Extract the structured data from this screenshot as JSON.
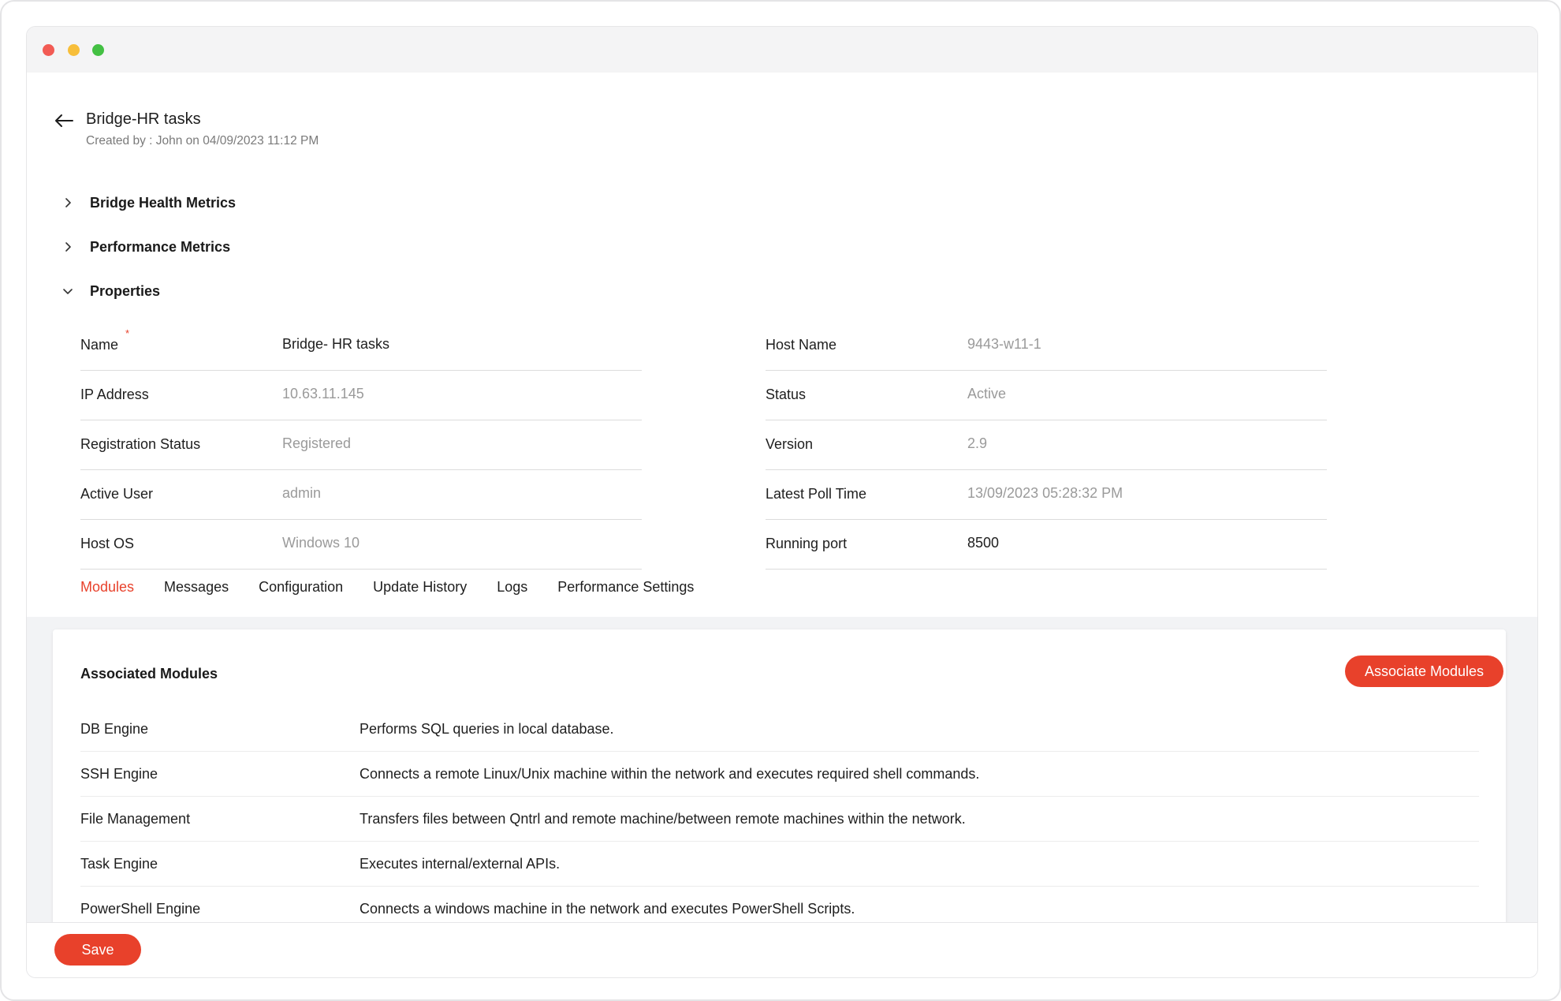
{
  "header": {
    "title": "Bridge-HR tasks",
    "subtitle": "Created by : John on 04/09/2023 11:12 PM"
  },
  "sections": {
    "health": "Bridge Health Metrics",
    "performance": "Performance Metrics",
    "properties": "Properties"
  },
  "properties": {
    "left": [
      {
        "label": "Name",
        "value": "Bridge- HR tasks",
        "required": "*"
      },
      {
        "label": "IP Address",
        "value": "10.63.11.145"
      },
      {
        "label": "Registration Status",
        "value": "Registered"
      },
      {
        "label": "Active User",
        "value": "admin"
      },
      {
        "label": "Host OS",
        "value": "Windows 10"
      }
    ],
    "right": [
      {
        "label": "Host Name",
        "value": "9443-w11-1"
      },
      {
        "label": "Status",
        "value": "Active"
      },
      {
        "label": "Version",
        "value": "2.9"
      },
      {
        "label": "Latest Poll Time",
        "value": "13/09/2023 05:28:32 PM"
      },
      {
        "label": "Running port",
        "value": "8500"
      }
    ]
  },
  "tabs": [
    {
      "label": "Modules",
      "active": true
    },
    {
      "label": "Messages"
    },
    {
      "label": "Configuration"
    },
    {
      "label": "Update History"
    },
    {
      "label": "Logs"
    },
    {
      "label": "Performance Settings"
    }
  ],
  "modules": {
    "title": "Associated Modules",
    "button_label": "Associate Modules",
    "rows": [
      {
        "name": "DB Engine",
        "description": "Performs SQL queries in local database."
      },
      {
        "name": "SSH Engine",
        "description": "Connects a remote Linux/Unix machine within the network and executes required shell commands."
      },
      {
        "name": "File Management",
        "description": "Transfers files between Qntrl and remote machine/between remote machines within the network."
      },
      {
        "name": "Task Engine",
        "description": "Executes internal/external APIs."
      },
      {
        "name": "PowerShell Engine",
        "description": "Connects a windows machine in the network and executes PowerShell Scripts."
      }
    ]
  },
  "footer": {
    "save_label": "Save"
  },
  "icons": {
    "back": "arrow-left-icon",
    "collapsed": "chevron-right-icon",
    "expanded": "chevron-down-icon"
  },
  "colors": {
    "accent": "#e8412b",
    "muted_text": "#9a9a9a",
    "window_chrome": "#f4f4f5",
    "band": "#f2f3f5"
  }
}
